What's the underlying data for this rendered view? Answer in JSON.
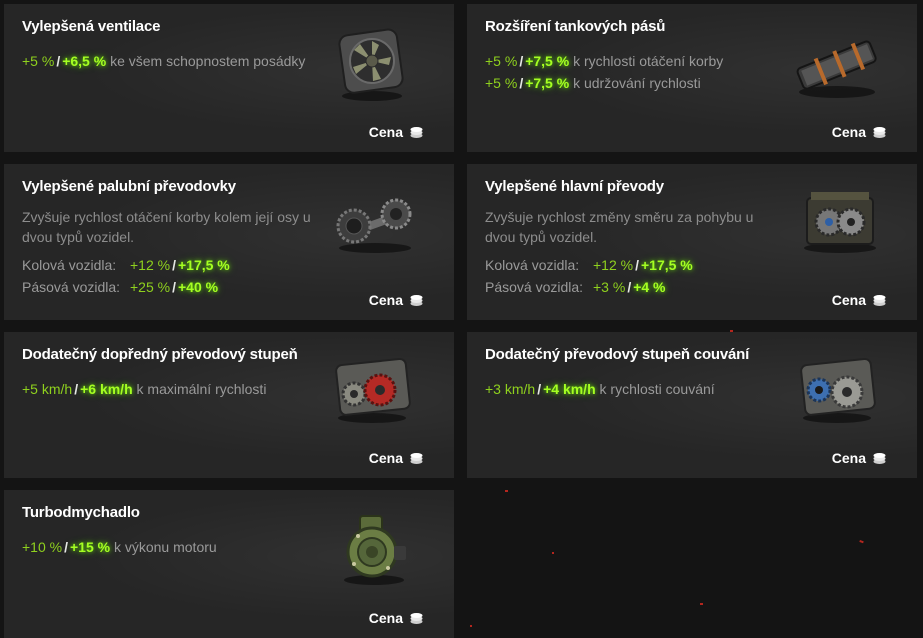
{
  "cards": [
    {
      "title": "Vylepšená ventilace",
      "effects": [
        {
          "v1": "+5 %",
          "sep": "/",
          "v2": "+6,5 %",
          "text": "ke všem schopnostem posádky"
        }
      ],
      "price_label": "Cena",
      "icon": "ventilation-fan-icon"
    },
    {
      "title": "Rozšíření tankových pásů",
      "effects": [
        {
          "v1": "+5 %",
          "sep": "/",
          "v2": "+7,5 %",
          "text": "k rychlosti otáčení korby"
        },
        {
          "v1": "+5 %",
          "sep": "/",
          "v2": "+7,5 %",
          "text": "k udržování rychlosti"
        }
      ],
      "price_label": "Cena",
      "icon": "track-link-icon"
    },
    {
      "title": "Vylepšené palubní převodovky",
      "description": "Zvyšuje rychlost otáčení korby kolem její osy u dvou typů vozidel.",
      "stats": [
        {
          "label": "Kolová vozidla:",
          "v1": "+12 %",
          "sep": "/",
          "v2": "+17,5 %"
        },
        {
          "label": "Pásová vozidla:",
          "v1": "+25 %",
          "sep": "/",
          "v2": "+40 %"
        }
      ],
      "price_label": "Cena",
      "icon": "final-drive-gears-icon"
    },
    {
      "title": "Vylepšené hlavní převody",
      "description": "Zvyšuje rychlost změny směru za pohybu u dvou typů vozidel.",
      "stats": [
        {
          "label": "Kolová vozidla:",
          "v1": "+12 %",
          "sep": "/",
          "v2": "+17,5 %"
        },
        {
          "label": "Pásová vozidla:",
          "v1": "+3 %",
          "sep": "/",
          "v2": "+4 %"
        }
      ],
      "price_label": "Cena",
      "icon": "main-gearbox-icon"
    },
    {
      "title": "Dodatečný dopředný převodový stupeň",
      "effects": [
        {
          "v1": "+5 km/h",
          "sep": "/",
          "v2": "+6 km/h",
          "text": "k maximální rychlosti"
        }
      ],
      "price_label": "Cena",
      "icon": "forward-gear-red-icon"
    },
    {
      "title": "Dodatečný převodový stupeň couvání",
      "effects": [
        {
          "v1": "+3 km/h",
          "sep": "/",
          "v2": "+4 km/h",
          "text": "k rychlosti couvání"
        }
      ],
      "price_label": "Cena",
      "icon": "reverse-gear-blue-icon"
    },
    {
      "title": "Turbodmychadlo",
      "effects": [
        {
          "v1": "+10 %",
          "sep": "/",
          "v2": "+15 %",
          "text": "k výkonu motoru"
        }
      ],
      "price_label": "Cena",
      "icon": "turbocharger-icon"
    }
  ],
  "colors": {
    "card_bg": "#262626",
    "page_bg": "#141414",
    "value_base": "#8fd11e",
    "value_bonus": "#a5ff22",
    "text_muted": "#9a9a9a",
    "title": "#ffffff"
  }
}
